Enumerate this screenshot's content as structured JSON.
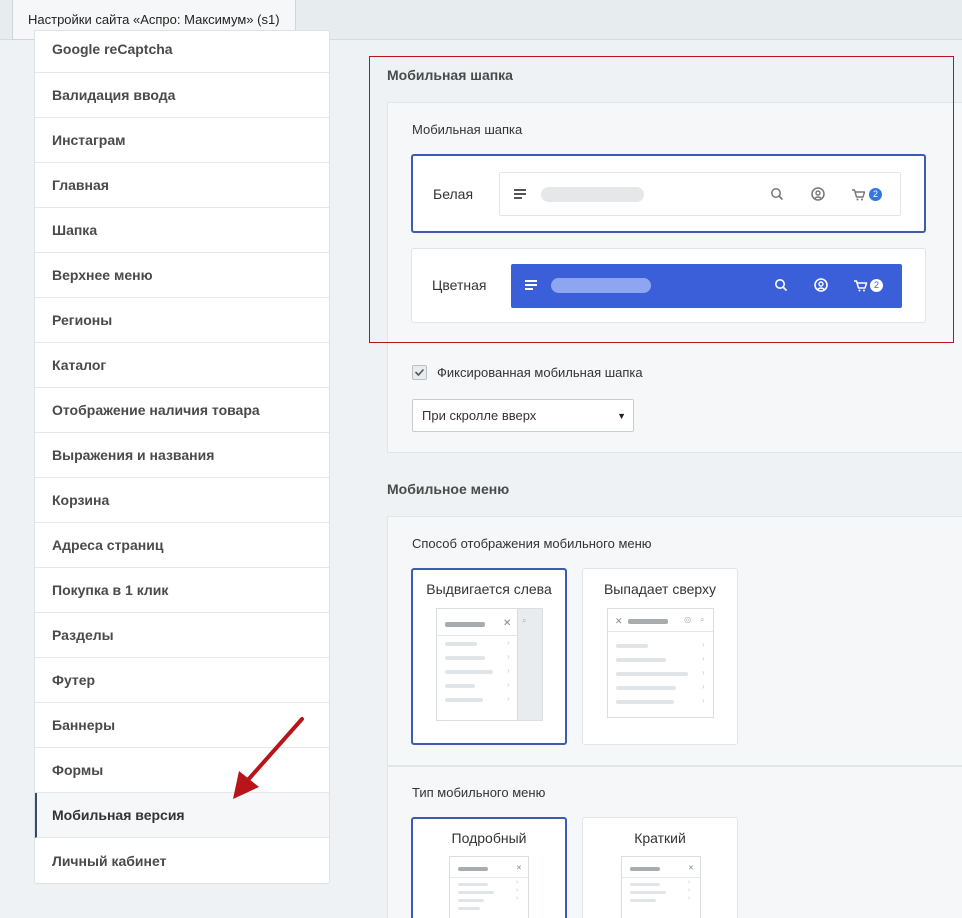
{
  "window": {
    "tab_title": "Настройки сайта «Аспро: Максимум» (s1)"
  },
  "sidebar": {
    "items": [
      {
        "label": "Google reCaptcha",
        "active": false
      },
      {
        "label": "Валидация ввода",
        "active": false
      },
      {
        "label": "Инстаграм",
        "active": false
      },
      {
        "label": "Главная",
        "active": false
      },
      {
        "label": "Шапка",
        "active": false
      },
      {
        "label": "Верхнее меню",
        "active": false
      },
      {
        "label": "Регионы",
        "active": false
      },
      {
        "label": "Каталог",
        "active": false
      },
      {
        "label": "Отображение наличия товара",
        "active": false
      },
      {
        "label": "Выражения и названия",
        "active": false
      },
      {
        "label": "Корзина",
        "active": false
      },
      {
        "label": "Адреса страниц",
        "active": false
      },
      {
        "label": "Покупка в 1 клик",
        "active": false
      },
      {
        "label": "Разделы",
        "active": false
      },
      {
        "label": "Футер",
        "active": false
      },
      {
        "label": "Баннеры",
        "active": false
      },
      {
        "label": "Формы",
        "active": false
      },
      {
        "label": "Мобильная версия",
        "active": true
      },
      {
        "label": "Личный кабинет",
        "active": false
      }
    ]
  },
  "mobile_header": {
    "section_title": "Мобильная шапка",
    "field_label": "Мобильная шапка",
    "options": [
      {
        "label": "Белая",
        "selected": true,
        "cart_count": "2"
      },
      {
        "label": "Цветная",
        "selected": false,
        "cart_count": "2"
      }
    ],
    "fixed_checkbox": {
      "label": "Фиксированная мобильная шапка",
      "checked": true
    },
    "scroll_select": {
      "value": "При скролле вверх"
    }
  },
  "mobile_menu": {
    "section_title": "Мобильное меню",
    "display_label": "Способ отображения мобильного меню",
    "display_options": [
      {
        "label": "Выдвигается слева",
        "selected": true
      },
      {
        "label": "Выпадает сверху",
        "selected": false
      }
    ],
    "type_label": "Тип мобильного меню",
    "type_options": [
      {
        "label": "Подробный",
        "selected": true
      },
      {
        "label": "Краткий",
        "selected": false
      }
    ]
  },
  "colors": {
    "accent": "#3e5bb3",
    "header_blue": "#3b5fd9",
    "annotation_red": "#b8141a"
  }
}
